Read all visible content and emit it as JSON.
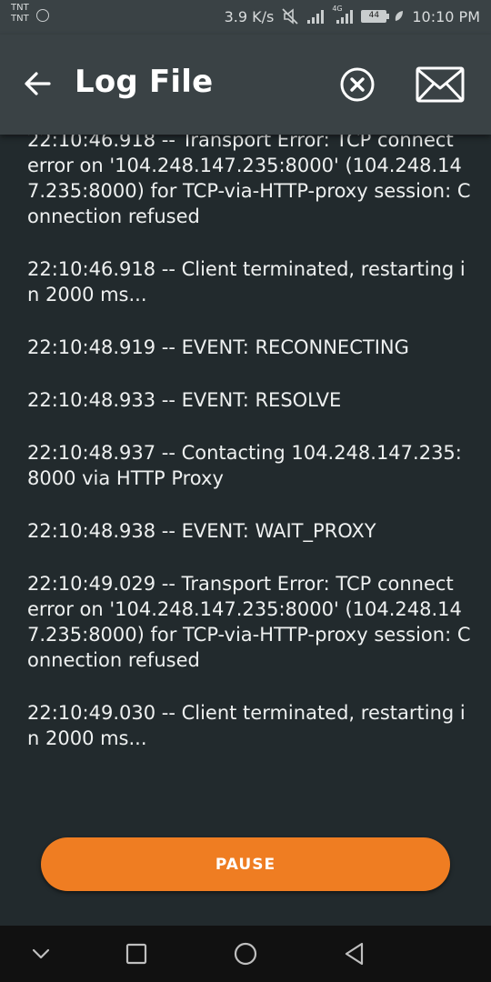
{
  "status_bar": {
    "carrier_1": "TNT",
    "carrier_2": "TNT",
    "network_speed": "3.9 K/s",
    "network_type": "4G",
    "battery_level": "44",
    "time": "10:10 PM",
    "icons": [
      "mute-icon",
      "signal-icon",
      "signal-4g-icon",
      "battery-icon",
      "charging-icon"
    ]
  },
  "app_bar": {
    "title": "Log File",
    "icons": [
      "back-arrow-icon",
      "clear-circle-x-icon",
      "mail-icon"
    ]
  },
  "log_entries": [
    "22:10:46.918 -- Transport Error: TCP connect error on '104.248.147.235:8000' (104.248.147.235:8000) for TCP-via-HTTP-proxy session: Connection refused",
    "22:10:46.918 -- Client terminated, restarting in 2000 ms...",
    "22:10:48.919 -- EVENT: RECONNECTING",
    "22:10:48.933 -- EVENT: RESOLVE",
    "22:10:48.937 -- Contacting 104.248.147.235:8000 via HTTP Proxy",
    "22:10:48.938 -- EVENT: WAIT_PROXY",
    "22:10:49.029 -- Transport Error: TCP connect error on '104.248.147.235:8000' (104.248.147.235:8000) for TCP-via-HTTP-proxy session: Connection refused",
    "22:10:49.030 -- Client terminated, restarting in 2000 ms..."
  ],
  "pause_button": {
    "label": "PAUSE"
  },
  "nav_bar": {
    "icons": [
      "nav-down-icon",
      "recents-square-icon",
      "home-circle-icon",
      "back-triangle-icon"
    ]
  },
  "colors": {
    "background": "#222a2d",
    "app_bar": "#3a4245",
    "accent": "#ef7d22",
    "nav_bar": "#111111"
  }
}
